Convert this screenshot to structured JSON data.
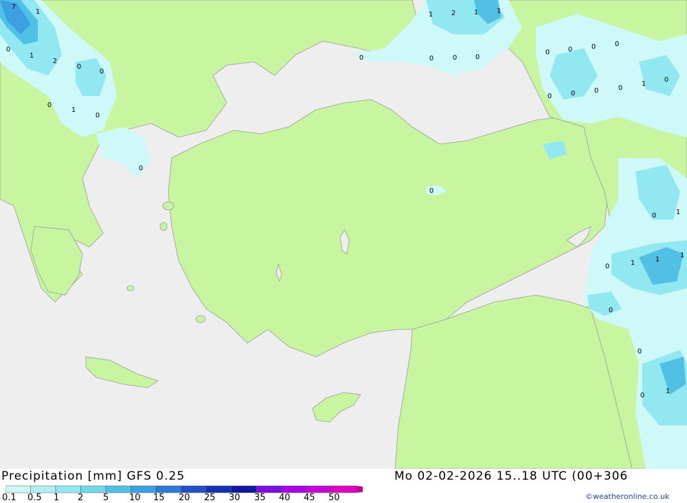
{
  "title_left": "Precipitation [mm] GFS 0.25",
  "title_right": "Mo 02-02-2026 15..18 UTC (00+306",
  "credit": "©weatheronline.co.uk",
  "legend": {
    "ticks": [
      "0.1",
      "0.5",
      "1",
      "2",
      "5",
      "10",
      "15",
      "20",
      "25",
      "30",
      "35",
      "40",
      "45",
      "50"
    ],
    "colors": [
      "#cff8f8",
      "#b0f0f5",
      "#92e8f0",
      "#72d8ea",
      "#50c0e4",
      "#3da0e0",
      "#2e7ad8",
      "#2050c8",
      "#1530b0",
      "#0d18a0",
      "#7a10e0",
      "#a800e8",
      "#c800d8",
      "#e000c0",
      "#c000a0"
    ]
  },
  "map_colors": {
    "sea": "#eeeeee",
    "land": "#c8f5a0",
    "border": "#999999"
  },
  "values": [
    {
      "t": "7"
    },
    {
      "t": "1"
    },
    {
      "t": "0"
    },
    {
      "t": "1"
    },
    {
      "t": "2"
    },
    {
      "t": "0"
    },
    {
      "t": "0"
    },
    {
      "t": "0"
    },
    {
      "t": "1"
    },
    {
      "t": "0"
    },
    {
      "t": "0"
    },
    {
      "t": "1"
    },
    {
      "t": "2"
    },
    {
      "t": "1"
    },
    {
      "t": "1"
    },
    {
      "t": "0"
    },
    {
      "t": "0"
    },
    {
      "t": "0"
    },
    {
      "t": "0"
    },
    {
      "t": "0"
    },
    {
      "t": "0"
    },
    {
      "t": "0"
    },
    {
      "t": "0"
    },
    {
      "t": "0"
    },
    {
      "t": "0"
    },
    {
      "t": "0"
    },
    {
      "t": "0"
    },
    {
      "t": "1"
    },
    {
      "t": "0"
    },
    {
      "t": "0"
    },
    {
      "t": "0"
    },
    {
      "t": "1"
    },
    {
      "t": "0"
    },
    {
      "t": "1"
    },
    {
      "t": "1"
    },
    {
      "t": "1"
    },
    {
      "t": "0"
    },
    {
      "t": "0"
    },
    {
      "t": "0"
    },
    {
      "t": "1"
    }
  ]
}
